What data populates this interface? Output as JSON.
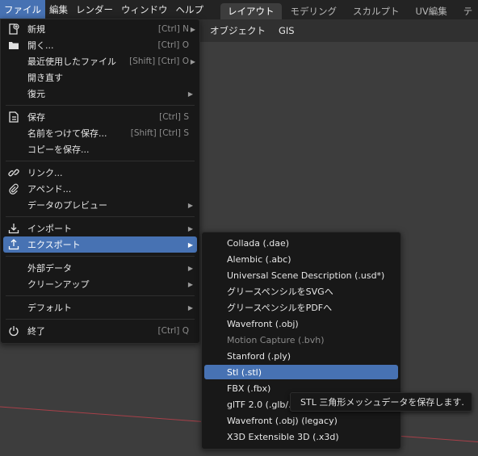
{
  "topbar": {
    "menus": [
      "ファイル",
      "編集",
      "レンダー",
      "ウィンドウ",
      "ヘルプ"
    ],
    "workspace_tabs": [
      "レイアウト",
      "モデリング",
      "スカルプト",
      "UV編集",
      "テ"
    ]
  },
  "viewport_header": {
    "menus": [
      "オブジェクト",
      "GIS"
    ]
  },
  "file_menu": {
    "new": {
      "label": "新規",
      "shortcut": "[Ctrl] N",
      "icon": "new-file-icon"
    },
    "open": {
      "label": "開く...",
      "shortcut": "[Ctrl] O",
      "icon": "folder-icon"
    },
    "recent": {
      "label": "最近使用したファイル",
      "shortcut": "[Shift] [Ctrl] O"
    },
    "revert": {
      "label": "開き直す"
    },
    "recover": {
      "label": "復元"
    },
    "save": {
      "label": "保存",
      "shortcut": "[Ctrl] S",
      "icon": "save-icon"
    },
    "save_as": {
      "label": "名前をつけて保存...",
      "shortcut": "[Shift] [Ctrl] S"
    },
    "save_copy": {
      "label": "コピーを保存..."
    },
    "link": {
      "label": "リンク...",
      "icon": "link-icon"
    },
    "append": {
      "label": "アペンド...",
      "icon": "paperclip-icon"
    },
    "data_preview": {
      "label": "データのプレビュー"
    },
    "import": {
      "label": "インポート",
      "icon": "import-icon"
    },
    "export": {
      "label": "エクスポート",
      "icon": "export-icon"
    },
    "external_data": {
      "label": "外部データ"
    },
    "cleanup": {
      "label": "クリーンアップ"
    },
    "defaults": {
      "label": "デフォルト"
    },
    "quit": {
      "label": "終了",
      "shortcut": "[Ctrl] Q",
      "icon": "power-icon"
    }
  },
  "export_menu": {
    "items": [
      "Collada (.dae)",
      "Alembic (.abc)",
      "Universal Scene Description (.usd*)",
      "グリースペンシルをSVGへ",
      "グリースペンシルをPDFへ",
      "Wavefront (.obj)",
      "Motion Capture (.bvh)",
      "Stanford (.ply)",
      "Stl (.stl)",
      "FBX (.fbx)",
      "glTF 2.0 (.glb/.gltf)",
      "Wavefront (.obj) (legacy)",
      "X3D Extensible 3D (.x3d)"
    ],
    "highlighted_index": 8,
    "disabled_index": 6
  },
  "tooltip": {
    "text": "STL 三角形メッシュデータを保存します."
  },
  "colors": {
    "accent": "#4772b3",
    "menu_bg": "#181818",
    "topbar_bg": "#232323"
  }
}
